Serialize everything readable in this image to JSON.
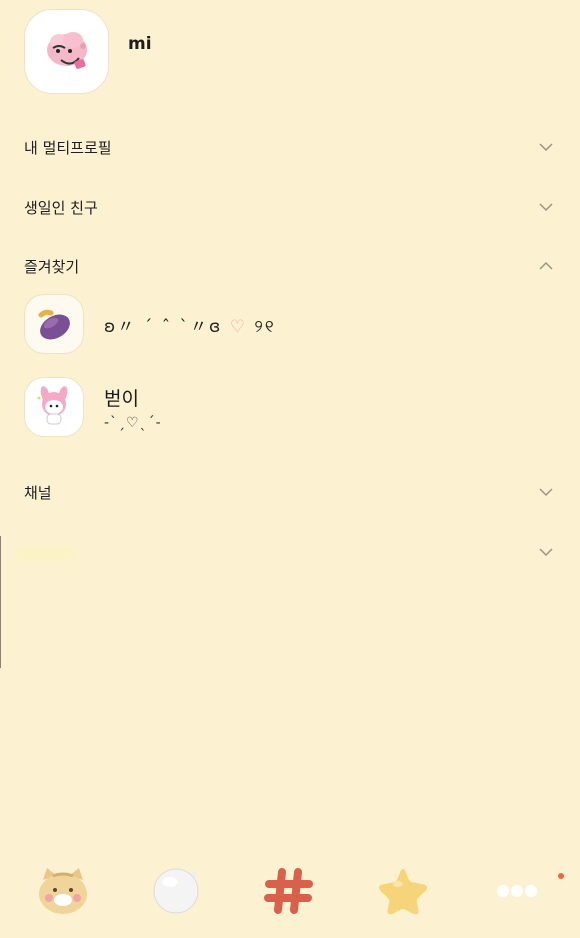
{
  "profile": {
    "name": "mi",
    "avatar_icon": "pink-character-avatar-icon"
  },
  "sections": {
    "multi_profile": "내 멀티프로필",
    "birthday_friends": "생일인 친구",
    "favorites": "즐겨찾기",
    "channel": "채널"
  },
  "favorites": [
    {
      "name": "",
      "status_text": "ʚ〃 ˊ ˆ ˋ〃ɞ",
      "status_heart": "♡",
      "status_tail": "୨୧",
      "avatar_icon": "sweet-potato-icon"
    },
    {
      "name": "벋이",
      "status_text": "-ˋˏ♡ˎˊ-",
      "avatar_icon": "my-melody-icon"
    }
  ],
  "bottom_nav": [
    {
      "name": "friends-tab",
      "icon": "cat-face-icon"
    },
    {
      "name": "chats-tab",
      "icon": "speech-bubble-icon"
    },
    {
      "name": "open-chat-tab",
      "icon": "hashtag-icon"
    },
    {
      "name": "shopping-tab",
      "icon": "star-icon"
    },
    {
      "name": "more-tab",
      "icon": "more-dots-icon"
    }
  ],
  "colors": {
    "background": "#fcf2d2",
    "badge": "#f06444",
    "hashtag": "#d9604a",
    "star": "#f6d57a"
  }
}
